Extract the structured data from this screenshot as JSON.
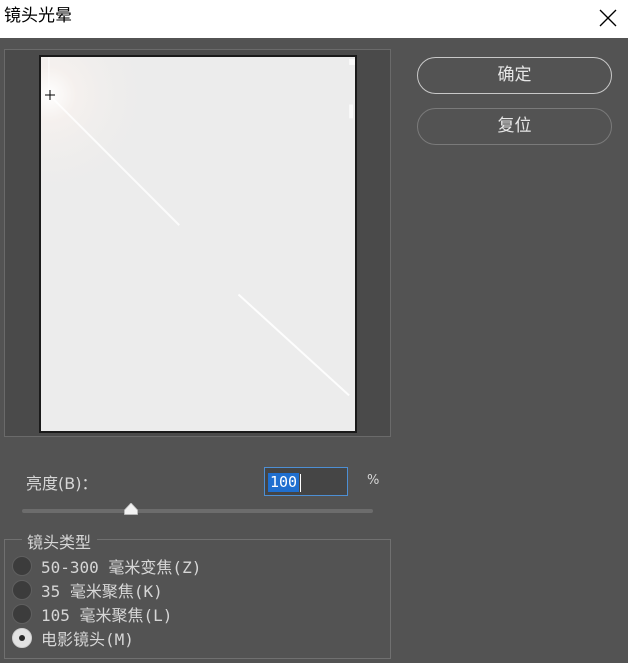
{
  "dialog": {
    "title": "镜头光晕"
  },
  "buttons": {
    "ok_label": "确定",
    "reset_label": "复位"
  },
  "brightness": {
    "label": "亮度(B)：",
    "value": "100",
    "unit": "%",
    "slider_fraction": 0.31
  },
  "lens_type": {
    "legend": "镜头类型",
    "options": [
      {
        "label": "50-300 毫米变焦(Z)",
        "selected": false
      },
      {
        "label": "35 毫米聚焦(K)",
        "selected": false
      },
      {
        "label": "105 毫米聚焦(L)",
        "selected": false
      },
      {
        "label": "电影镜头(M)",
        "selected": true
      }
    ]
  },
  "colors": {
    "dialog_bg": "#535353",
    "titlebar_bg": "#ffffff",
    "input_highlight": "#1f6fcf",
    "preview_bg": "#ececec"
  },
  "icons": {
    "close": "close-icon",
    "flare_center": "crosshair-icon",
    "slider_thumb": "triangle-up-icon"
  }
}
